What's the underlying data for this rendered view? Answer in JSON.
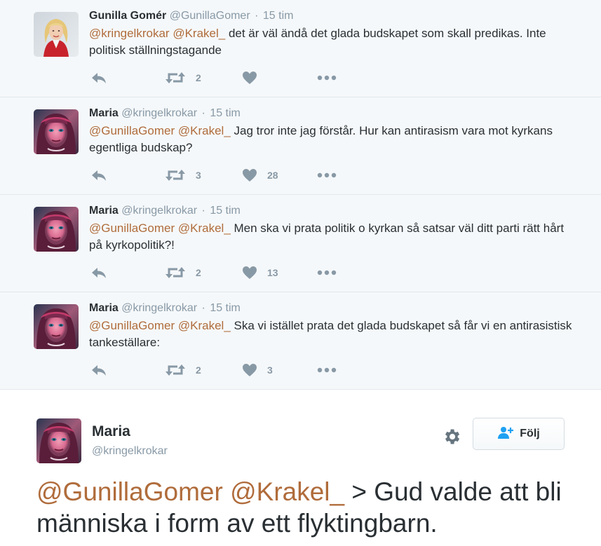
{
  "tweets": [
    {
      "avatar": "blonde-woman-red-jacket",
      "fullname": "Gunilla Gomér",
      "handle": "@GunillaGomer",
      "time": "15 tim",
      "mentions": [
        "@kringelkrokar",
        "@Krakel_"
      ],
      "body": " det är väl ändå det glada budskapet som skall predikas. Inte politisk ställningstagande",
      "retweets": "2",
      "likes": ""
    },
    {
      "avatar": "woman-dark-hair-pink",
      "fullname": "Maria",
      "handle": "@kringelkrokar",
      "time": "15 tim",
      "mentions": [
        "@GunillaGomer",
        "@Krakel_"
      ],
      "body": "Jag tror inte jag förstår. Hur kan antirasism vara mot kyrkans egentliga budskap?",
      "retweets": "3",
      "likes": "28"
    },
    {
      "avatar": "woman-dark-hair-pink",
      "fullname": "Maria",
      "handle": "@kringelkrokar",
      "time": "15 tim",
      "mentions": [
        "@GunillaGomer",
        "@Krakel_"
      ],
      "body": "Men ska vi prata politik o kyrkan så satsar väl ditt parti rätt hårt på kyrkopolitik?!",
      "retweets": "2",
      "likes": "13"
    },
    {
      "avatar": "woman-dark-hair-pink",
      "fullname": "Maria",
      "handle": "@kringelkrokar",
      "time": "15 tim",
      "mentions": [
        "@GunillaGomer",
        "@Krakel_"
      ],
      "body": "Ska vi istället prata det glada budskapet så får vi en antirasistisk tankeställare:",
      "retweets": "2",
      "likes": "3"
    }
  ],
  "main_tweet": {
    "fullname": "Maria",
    "handle": "@kringelkrokar",
    "follow_label": "Följ",
    "mentions": [
      "@GunillaGomer",
      "@Krakel_"
    ],
    "body": " > Gud valde att bli människa i form av ett flyktingbarn."
  },
  "separator": "·",
  "icons": {
    "reply": "reply-icon",
    "retweet": "retweet-icon",
    "like": "heart-icon",
    "more": "more-dots-icon",
    "settings": "gear-icon",
    "follow": "follow-user-icon"
  },
  "colors": {
    "mention": "#b06c3b",
    "muted": "#8899a6",
    "text": "#292f33",
    "tweet_bg": "#f5f8fa"
  }
}
